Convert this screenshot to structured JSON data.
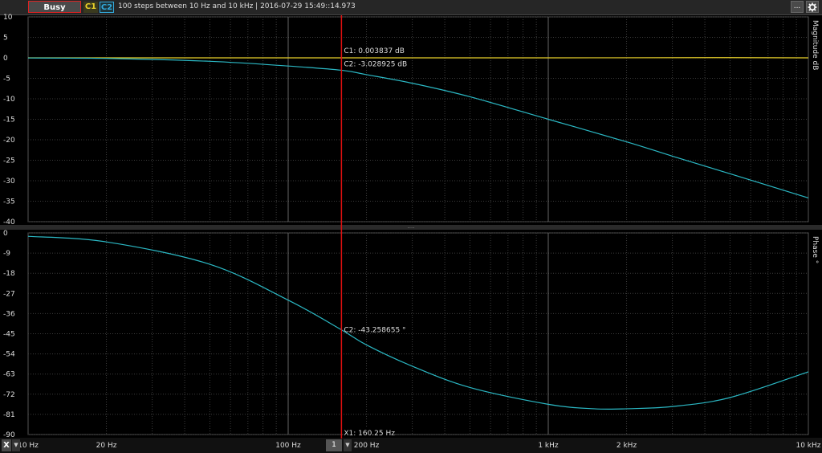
{
  "toolbar": {
    "status": "Busy",
    "channel1": "C1",
    "channel2": "C2",
    "info": "100 steps  between 10 Hz and 10 kHz | 2016-07-29 15:49::14.973",
    "menu_label": "...",
    "settings_icon": "gear-icon"
  },
  "colors": {
    "c1": "#e8d02a",
    "c2": "#2bb8c4",
    "cursor": "#e01010",
    "grid": "#3c3c3c"
  },
  "cursor": {
    "selector_value": "1",
    "x_label": "X1: 160.25 Hz",
    "x_value": 160.25,
    "mag_c1_label": "C1: 0.003837 dB",
    "mag_c2_label": "C2: -3.028925 dB",
    "phase_c2_label": "C2: -43.258655 °"
  },
  "x_axis_button": "X",
  "chart_data": [
    {
      "type": "line",
      "name": "magnitude",
      "ylabel": "Magnitude dB",
      "x_scale": "log",
      "xlim": [
        10,
        10000
      ],
      "ylim": [
        -40,
        10
      ],
      "yticks": [
        10,
        5,
        0,
        -5,
        -10,
        -15,
        -20,
        -25,
        -30,
        -35,
        -40
      ],
      "grid": true,
      "series": [
        {
          "name": "C1",
          "x": [
            10,
            100,
            160.25,
            1000,
            5000,
            10000
          ],
          "y": [
            0.0,
            0.0,
            0.0038,
            0.0,
            0.05,
            0.0
          ]
        },
        {
          "name": "C2",
          "x": [
            10,
            20,
            50,
            100,
            160.25,
            200,
            300,
            500,
            1000,
            2000,
            3000,
            5000,
            10000
          ],
          "y": [
            -0.04,
            -0.15,
            -0.85,
            -2.0,
            -3.03,
            -4.1,
            -6.2,
            -9.5,
            -15.0,
            -20.5,
            -24.0,
            -28.3,
            -34.2
          ]
        }
      ]
    },
    {
      "type": "line",
      "name": "phase",
      "ylabel": "Phase °",
      "x_scale": "log",
      "xlim": [
        10,
        10000
      ],
      "ylim": [
        -90,
        0
      ],
      "yticks": [
        0,
        -9,
        -18,
        -27,
        -36,
        -45,
        -54,
        -63,
        -72,
        -81,
        -90
      ],
      "grid": true,
      "series": [
        {
          "name": "C2",
          "x": [
            10,
            20,
            50,
            100,
            160.25,
            200,
            300,
            500,
            1000,
            1500,
            2000,
            3000,
            5000,
            10000
          ],
          "y": [
            -1.5,
            -4.0,
            -14.0,
            -30.0,
            -43.26,
            -50.0,
            -59.5,
            -69.0,
            -76.5,
            -78.5,
            -78.5,
            -77.5,
            -73.5,
            -62.0
          ]
        }
      ]
    }
  ],
  "x_ticks": [
    {
      "value": 10,
      "label": "10 Hz"
    },
    {
      "value": 20,
      "label": "20 Hz"
    },
    {
      "value": 100,
      "label": "100 Hz"
    },
    {
      "value": 200,
      "label": "200 Hz"
    },
    {
      "value": 1000,
      "label": "1 kHz"
    },
    {
      "value": 2000,
      "label": "2 kHz"
    },
    {
      "value": 10000,
      "label": "10 kHz"
    }
  ]
}
